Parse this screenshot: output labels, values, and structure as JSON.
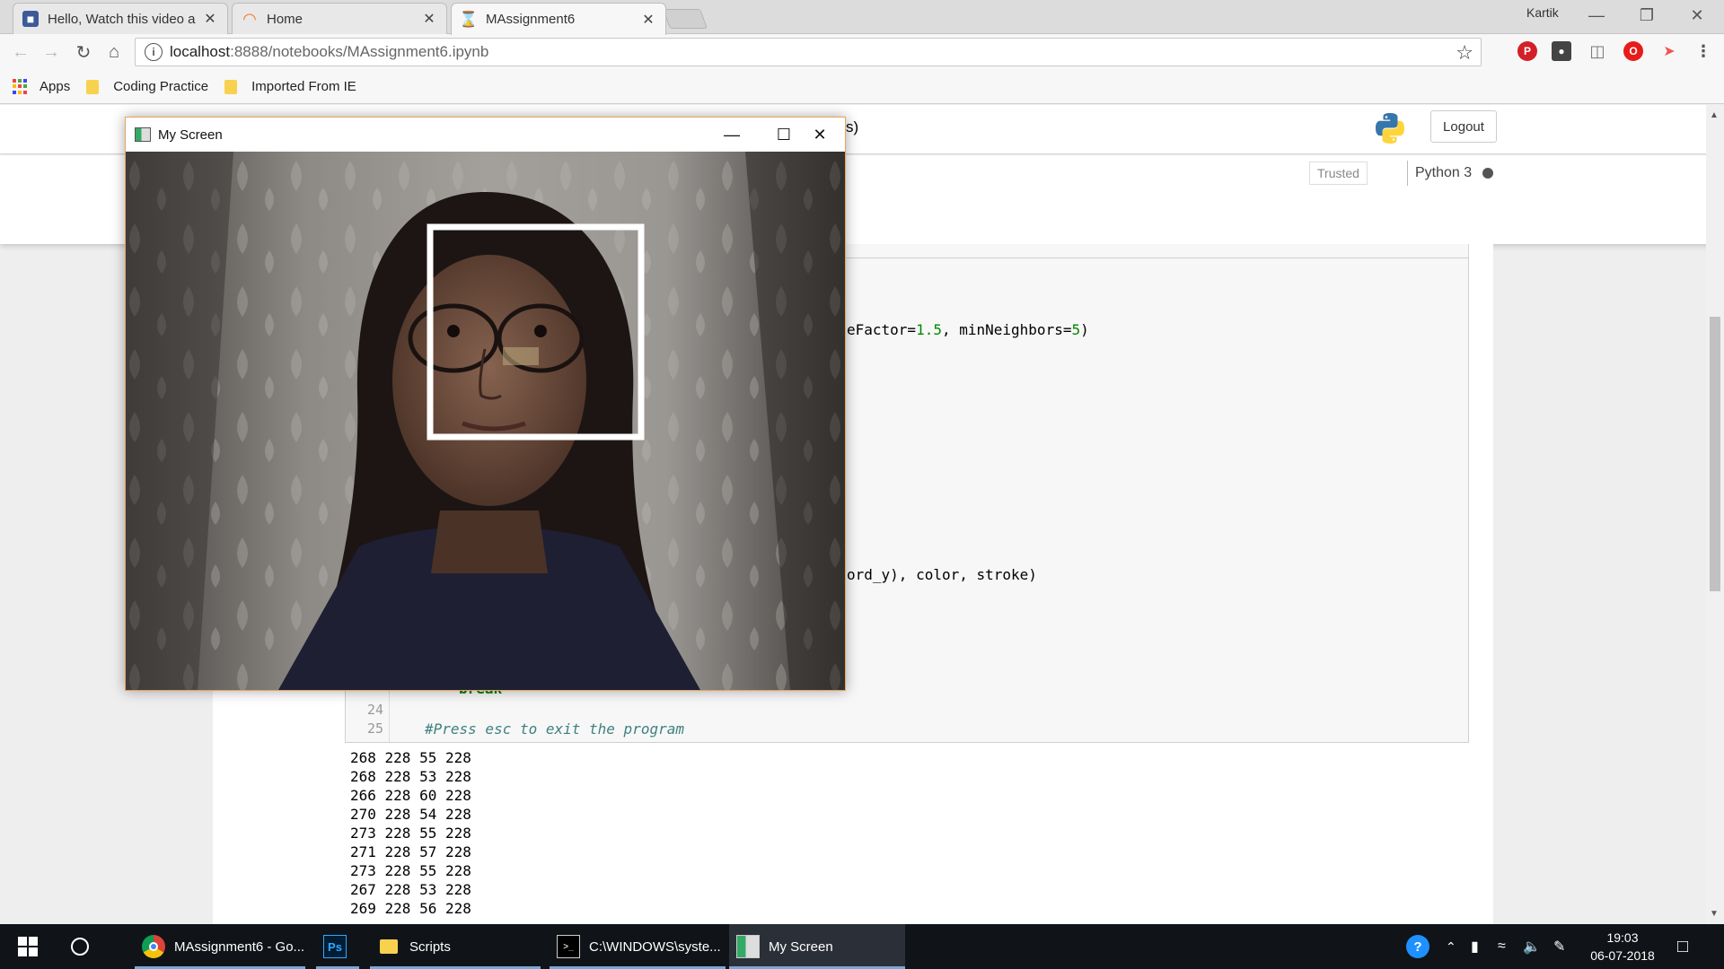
{
  "browser": {
    "tabs": [
      {
        "title": "Hello, Watch this video a",
        "active": false
      },
      {
        "title": "Home",
        "active": false
      },
      {
        "title": "MAssignment6",
        "active": true
      }
    ],
    "profile": "Kartik",
    "url_host": "localhost",
    "url_rest": ":8888/notebooks/MAssignment6.ipynb",
    "bookmarks": [
      "Apps",
      "Coding Practice",
      "Imported From IE"
    ]
  },
  "jupyter": {
    "logout": "Logout",
    "trusted": "Trusted",
    "kernel": "Python 3",
    "header_fragment": "s)",
    "code_lines": [
      {
        "text_pre": "eFactor=",
        "num1": "1.5",
        "mid": ", minNeighbors=",
        "num2": "5",
        "post": ")"
      },
      {
        "text": "ord_y), color, stroke)"
      },
      {
        "text": "break"
      }
    ],
    "gutter": [
      "24",
      "25"
    ],
    "comment": "#Press esc to exit the program",
    "output_rows": [
      "268 228 55 228",
      "268 228 53 228",
      "266 228 60 228",
      "270 228 54 228",
      "273 228 55 228",
      "271 228 57 228",
      "273 228 55 228",
      "267 228 53 228",
      "269 228 56 228"
    ]
  },
  "cv_window": {
    "title": "My Screen"
  },
  "taskbar": {
    "items": [
      {
        "label": "MAssignment6 - Go...",
        "icon": "chrome-icon"
      },
      {
        "label": "",
        "icon": "photoshop-icon",
        "text": "Ps"
      },
      {
        "label": "Scripts",
        "icon": "folder-icon"
      },
      {
        "label": "C:\\WINDOWS\\syste...",
        "icon": "cmd-icon"
      },
      {
        "label": "My Screen",
        "icon": "opencv-window-icon"
      }
    ],
    "time": "19:03",
    "date": "06-07-2018"
  }
}
